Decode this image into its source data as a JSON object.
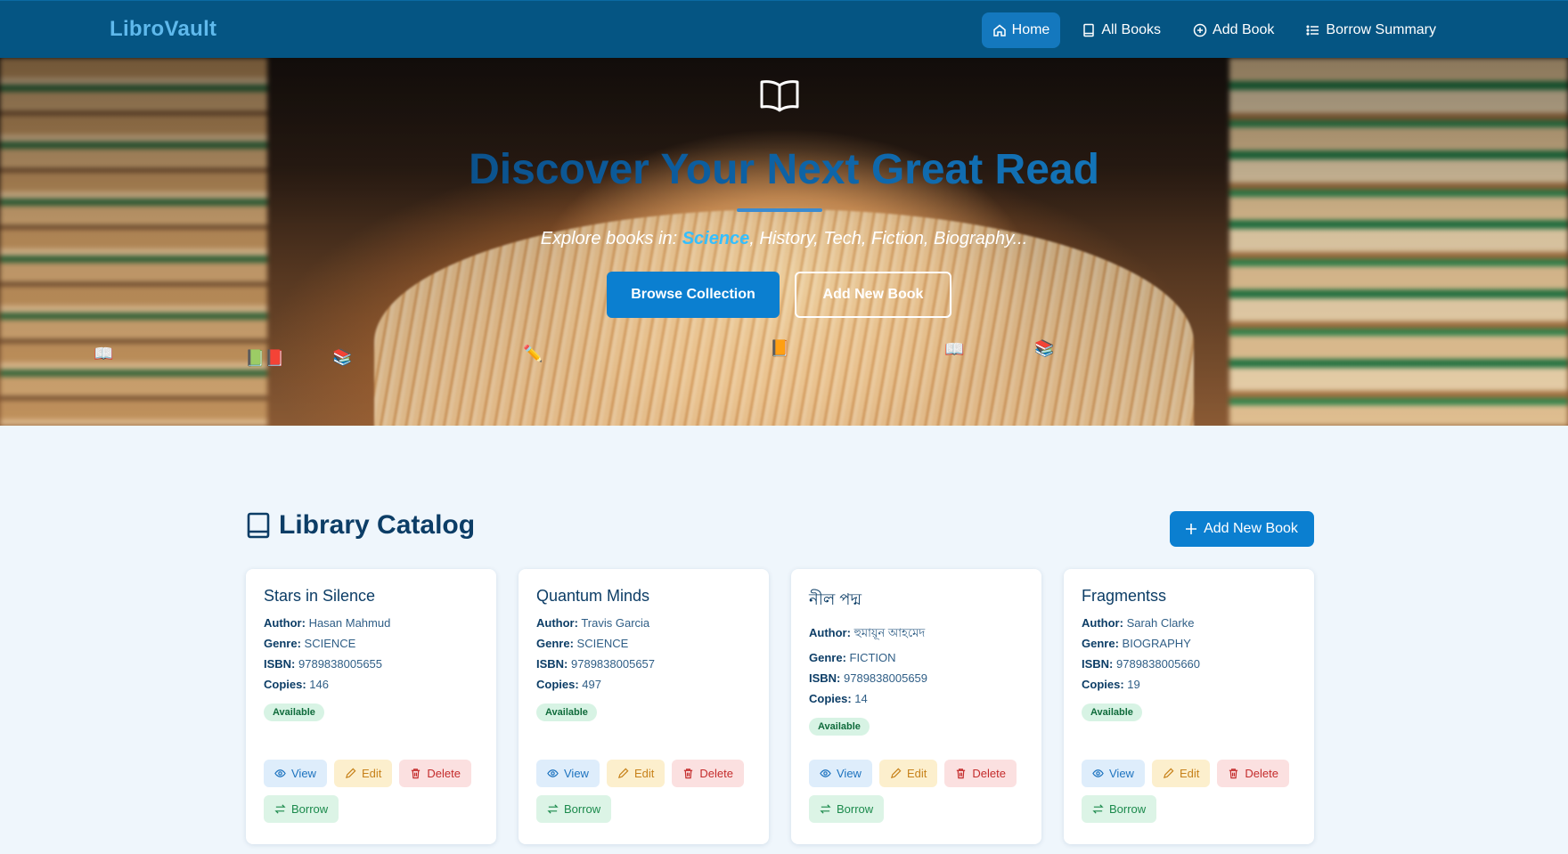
{
  "brand": "LibroVault",
  "nav": [
    {
      "label": "Home",
      "icon": "home-icon",
      "active": true
    },
    {
      "label": "All Books",
      "icon": "book-icon",
      "active": false
    },
    {
      "label": "Add Book",
      "icon": "plus-circle-icon",
      "active": false
    },
    {
      "label": "Borrow Summary",
      "icon": "list-icon",
      "active": false
    }
  ],
  "hero": {
    "title": "Discover Your Next Great Read",
    "subtitle_prefix": "Explore books in: ",
    "subtitle_highlight": "Science",
    "subtitle_rest": ", History, Tech, Fiction, Biography...",
    "browse_label": "Browse Collection",
    "add_label": "Add New Book",
    "floating_icons": [
      "📖",
      "📗📕",
      "📚",
      "✏️",
      "📙",
      "📖",
      "📚"
    ]
  },
  "catalog": {
    "title": "Library Catalog",
    "add_button": "Add New Book",
    "labels": {
      "author": "Author:",
      "genre": "Genre:",
      "isbn": "ISBN:",
      "copies": "Copies:"
    },
    "actions": {
      "view": "View",
      "edit": "Edit",
      "delete": "Delete",
      "borrow": "Borrow"
    },
    "books": [
      {
        "title": "Stars in Silence",
        "author": "Hasan Mahmud",
        "genre": "SCIENCE",
        "isbn": "9789838005655",
        "copies": "146",
        "status": "Available"
      },
      {
        "title": "Quantum Minds",
        "author": "Travis Garcia",
        "genre": "SCIENCE",
        "isbn": "9789838005657",
        "copies": "497",
        "status": "Available"
      },
      {
        "title": "নীল পদ্ম",
        "author": "হুমায়ূন আহমেদ",
        "genre": "FICTION",
        "isbn": "9789838005659",
        "copies": "14",
        "status": "Available"
      },
      {
        "title": "Fragmentss",
        "author": "Sarah Clarke",
        "genre": "BIOGRAPHY",
        "isbn": "9789838005660",
        "copies": "19",
        "status": "Available"
      }
    ]
  },
  "colors": {
    "nav_bg": "#055583",
    "brand": "#5fb9ec",
    "primary": "#0b7fd0",
    "page_bg": "#eff6fc",
    "available_bg": "#d7f3e4"
  }
}
